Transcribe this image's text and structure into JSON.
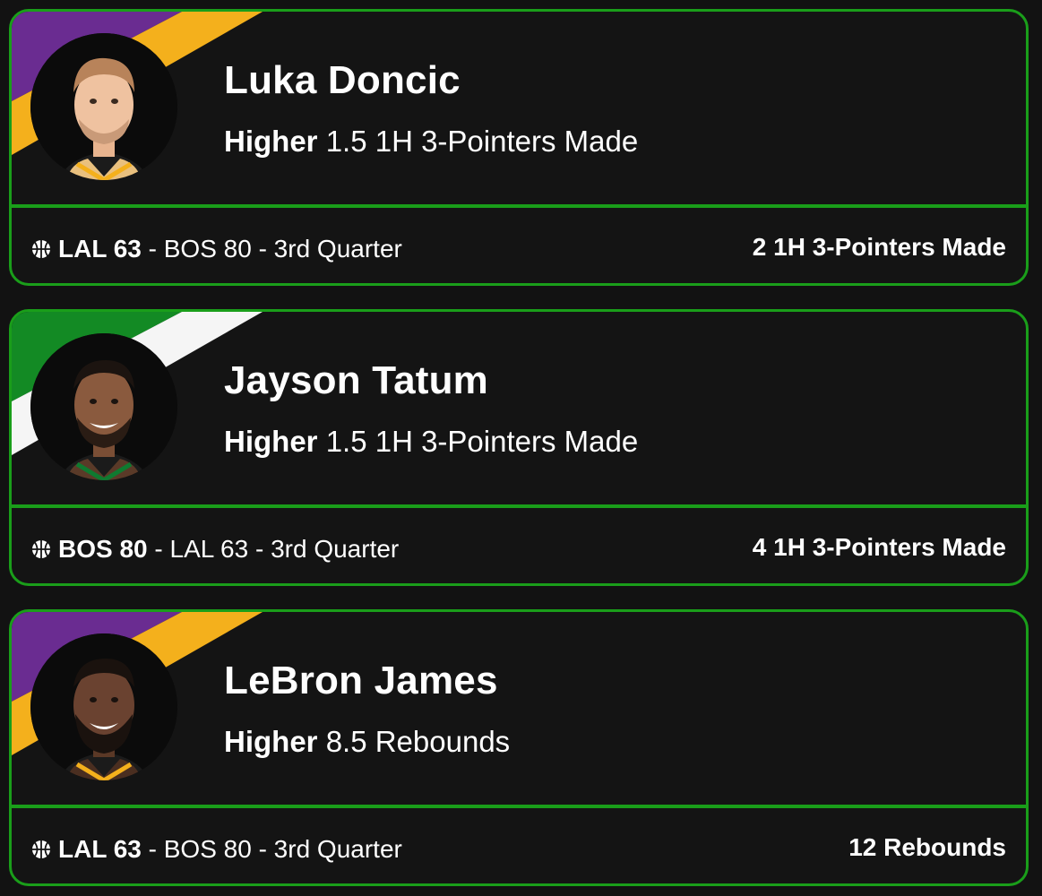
{
  "cards": [
    {
      "player": "Luka Doncic",
      "direction": "Higher",
      "line": "1.5 1H 3-Pointers Made",
      "team_score": "LAL 63",
      "rest": "- BOS 80 - 3rd Quarter",
      "result": "2 1H 3-Pointers Made",
      "team_colors": [
        "#6a2c91",
        "#f4b01c"
      ],
      "jersey_color": "#f4b01c"
    },
    {
      "player": "Jayson Tatum",
      "direction": "Higher",
      "line": "1.5 1H 3-Pointers Made",
      "team_score": "BOS 80",
      "rest": "- LAL 63 - 3rd Quarter",
      "result": "4 1H 3-Pointers Made",
      "team_colors": [
        "#138a24",
        "#f5f5f5"
      ],
      "jersey_color": "#0f7a30"
    },
    {
      "player": "LeBron James",
      "direction": "Higher",
      "line": "8.5 Rebounds",
      "team_score": "LAL 63",
      "rest": "- BOS 80 - 3rd Quarter",
      "result": "12 Rebounds",
      "team_colors": [
        "#6a2c91",
        "#f4b01c"
      ],
      "jersey_color": "#f4b01c"
    }
  ],
  "accent_color": "#1a9e1a",
  "icons": {
    "sport": "basketball-icon",
    "avatar": "player-headshot"
  }
}
